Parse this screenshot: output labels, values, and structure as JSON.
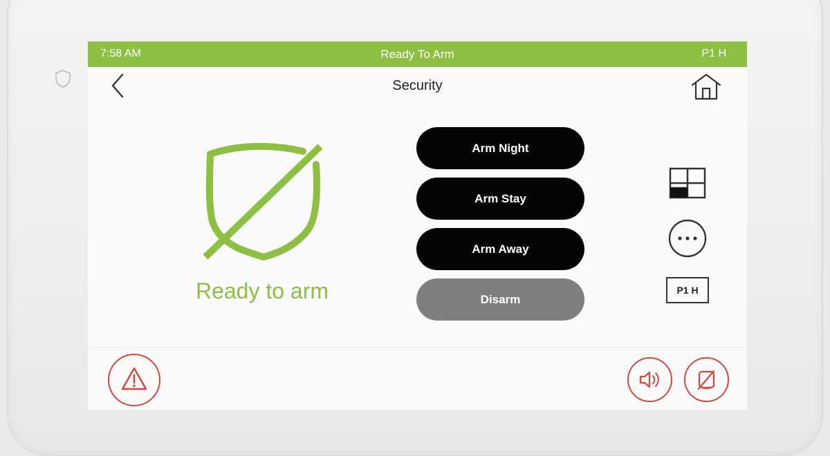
{
  "status_bar": {
    "time": "7:58 AM",
    "status_text": "Ready To Arm",
    "partition": "P1 H",
    "color": "#8dc042"
  },
  "header": {
    "title": "Security",
    "back_icon": "chevron-left-icon",
    "home_icon": "home-icon"
  },
  "security_status": {
    "label": "Ready to arm",
    "icon": "shield-disabled-icon",
    "color": "#8dc042"
  },
  "arm_buttons": {
    "arm_night": "Arm Night",
    "arm_stay": "Arm Stay",
    "arm_away": "Arm Away",
    "disarm": "Disarm"
  },
  "side_panel": {
    "tiles_icon": "tiles-icon",
    "more_icon": "more-options-icon",
    "partition_label": "P1 H"
  },
  "footer": {
    "panic_icon": "warning-icon",
    "volume_icon": "speaker-icon",
    "chime_icon": "chime-off-icon",
    "accent_color": "#d8463a"
  }
}
